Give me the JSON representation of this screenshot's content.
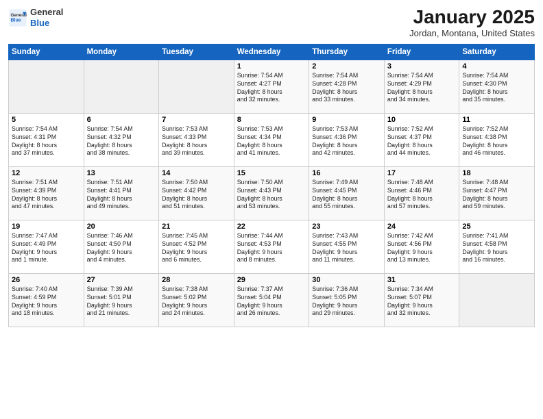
{
  "header": {
    "logo_general": "General",
    "logo_blue": "Blue",
    "title": "January 2025",
    "location": "Jordan, Montana, United States"
  },
  "days_of_week": [
    "Sunday",
    "Monday",
    "Tuesday",
    "Wednesday",
    "Thursday",
    "Friday",
    "Saturday"
  ],
  "weeks": [
    [
      {
        "day": "",
        "info": ""
      },
      {
        "day": "",
        "info": ""
      },
      {
        "day": "",
        "info": ""
      },
      {
        "day": "1",
        "info": "Sunrise: 7:54 AM\nSunset: 4:27 PM\nDaylight: 8 hours\nand 32 minutes."
      },
      {
        "day": "2",
        "info": "Sunrise: 7:54 AM\nSunset: 4:28 PM\nDaylight: 8 hours\nand 33 minutes."
      },
      {
        "day": "3",
        "info": "Sunrise: 7:54 AM\nSunset: 4:29 PM\nDaylight: 8 hours\nand 34 minutes."
      },
      {
        "day": "4",
        "info": "Sunrise: 7:54 AM\nSunset: 4:30 PM\nDaylight: 8 hours\nand 35 minutes."
      }
    ],
    [
      {
        "day": "5",
        "info": "Sunrise: 7:54 AM\nSunset: 4:31 PM\nDaylight: 8 hours\nand 37 minutes."
      },
      {
        "day": "6",
        "info": "Sunrise: 7:54 AM\nSunset: 4:32 PM\nDaylight: 8 hours\nand 38 minutes."
      },
      {
        "day": "7",
        "info": "Sunrise: 7:53 AM\nSunset: 4:33 PM\nDaylight: 8 hours\nand 39 minutes."
      },
      {
        "day": "8",
        "info": "Sunrise: 7:53 AM\nSunset: 4:34 PM\nDaylight: 8 hours\nand 41 minutes."
      },
      {
        "day": "9",
        "info": "Sunrise: 7:53 AM\nSunset: 4:36 PM\nDaylight: 8 hours\nand 42 minutes."
      },
      {
        "day": "10",
        "info": "Sunrise: 7:52 AM\nSunset: 4:37 PM\nDaylight: 8 hours\nand 44 minutes."
      },
      {
        "day": "11",
        "info": "Sunrise: 7:52 AM\nSunset: 4:38 PM\nDaylight: 8 hours\nand 46 minutes."
      }
    ],
    [
      {
        "day": "12",
        "info": "Sunrise: 7:51 AM\nSunset: 4:39 PM\nDaylight: 8 hours\nand 47 minutes."
      },
      {
        "day": "13",
        "info": "Sunrise: 7:51 AM\nSunset: 4:41 PM\nDaylight: 8 hours\nand 49 minutes."
      },
      {
        "day": "14",
        "info": "Sunrise: 7:50 AM\nSunset: 4:42 PM\nDaylight: 8 hours\nand 51 minutes."
      },
      {
        "day": "15",
        "info": "Sunrise: 7:50 AM\nSunset: 4:43 PM\nDaylight: 8 hours\nand 53 minutes."
      },
      {
        "day": "16",
        "info": "Sunrise: 7:49 AM\nSunset: 4:45 PM\nDaylight: 8 hours\nand 55 minutes."
      },
      {
        "day": "17",
        "info": "Sunrise: 7:48 AM\nSunset: 4:46 PM\nDaylight: 8 hours\nand 57 minutes."
      },
      {
        "day": "18",
        "info": "Sunrise: 7:48 AM\nSunset: 4:47 PM\nDaylight: 8 hours\nand 59 minutes."
      }
    ],
    [
      {
        "day": "19",
        "info": "Sunrise: 7:47 AM\nSunset: 4:49 PM\nDaylight: 9 hours\nand 1 minute."
      },
      {
        "day": "20",
        "info": "Sunrise: 7:46 AM\nSunset: 4:50 PM\nDaylight: 9 hours\nand 4 minutes."
      },
      {
        "day": "21",
        "info": "Sunrise: 7:45 AM\nSunset: 4:52 PM\nDaylight: 9 hours\nand 6 minutes."
      },
      {
        "day": "22",
        "info": "Sunrise: 7:44 AM\nSunset: 4:53 PM\nDaylight: 9 hours\nand 8 minutes."
      },
      {
        "day": "23",
        "info": "Sunrise: 7:43 AM\nSunset: 4:55 PM\nDaylight: 9 hours\nand 11 minutes."
      },
      {
        "day": "24",
        "info": "Sunrise: 7:42 AM\nSunset: 4:56 PM\nDaylight: 9 hours\nand 13 minutes."
      },
      {
        "day": "25",
        "info": "Sunrise: 7:41 AM\nSunset: 4:58 PM\nDaylight: 9 hours\nand 16 minutes."
      }
    ],
    [
      {
        "day": "26",
        "info": "Sunrise: 7:40 AM\nSunset: 4:59 PM\nDaylight: 9 hours\nand 18 minutes."
      },
      {
        "day": "27",
        "info": "Sunrise: 7:39 AM\nSunset: 5:01 PM\nDaylight: 9 hours\nand 21 minutes."
      },
      {
        "day": "28",
        "info": "Sunrise: 7:38 AM\nSunset: 5:02 PM\nDaylight: 9 hours\nand 24 minutes."
      },
      {
        "day": "29",
        "info": "Sunrise: 7:37 AM\nSunset: 5:04 PM\nDaylight: 9 hours\nand 26 minutes."
      },
      {
        "day": "30",
        "info": "Sunrise: 7:36 AM\nSunset: 5:05 PM\nDaylight: 9 hours\nand 29 minutes."
      },
      {
        "day": "31",
        "info": "Sunrise: 7:34 AM\nSunset: 5:07 PM\nDaylight: 9 hours\nand 32 minutes."
      },
      {
        "day": "",
        "info": ""
      }
    ]
  ]
}
